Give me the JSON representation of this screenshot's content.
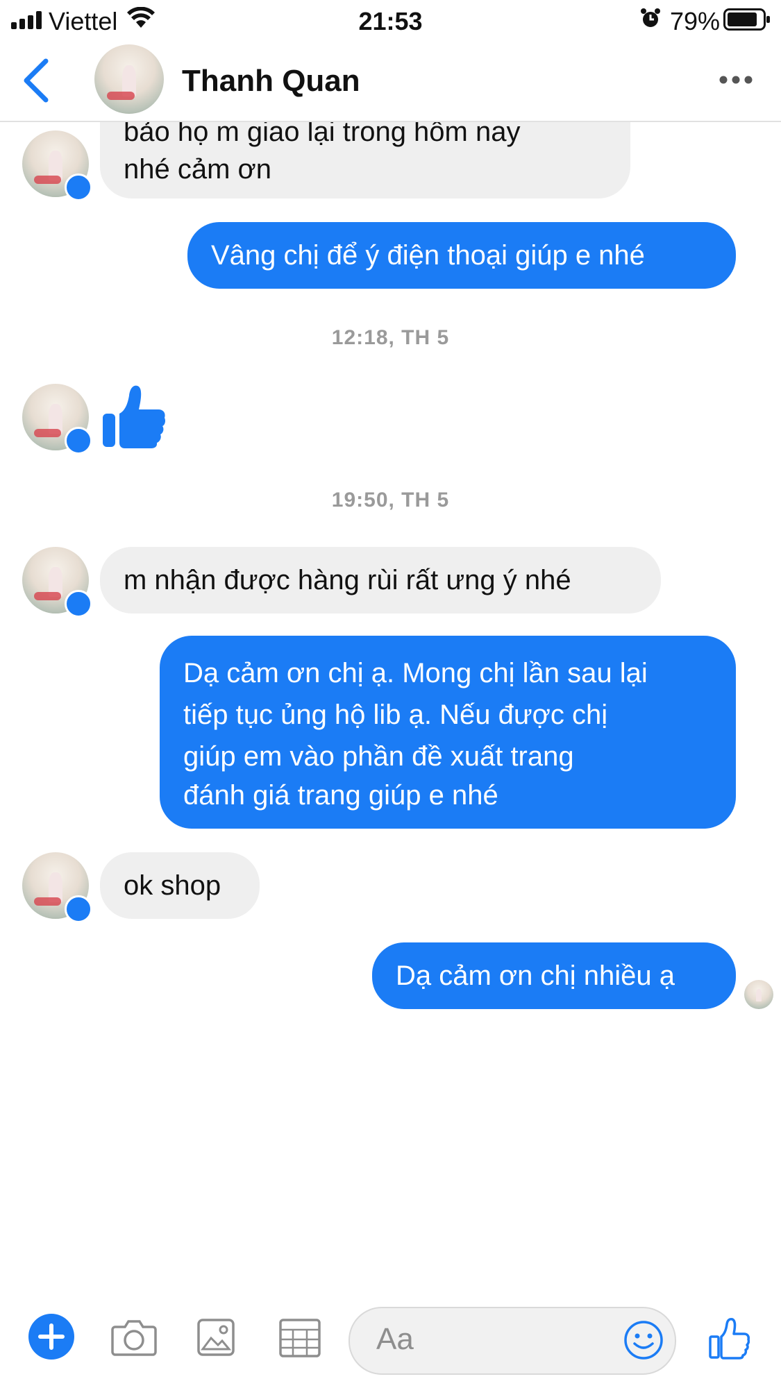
{
  "status_bar": {
    "carrier": "Viettel",
    "time": "21:53",
    "battery": "79%"
  },
  "header": {
    "contact_name": "Thanh Quan"
  },
  "messages": {
    "m1_line1": "bảo họ m giao lại trong hôm nay",
    "m1_line2": "nhé cảm ơn",
    "m2": "Vâng chị để ý điện thoại giúp e nhé",
    "ts1": "12:18, TH 5",
    "ts2": "19:50, TH 5",
    "m3": "m nhận được hàng rùi rất ưng ý nhé",
    "m4_line1": "Dạ cảm ơn chị ạ. Mong chị lần sau lại",
    "m4_line2": "tiếp tục ủng hộ lib ạ. Nếu được chị",
    "m4_line3": "giúp em vào phần đề xuất trang",
    "m4_line4": "đánh giá trang giúp e nhé",
    "m5": "ok shop",
    "m6": "Dạ cảm ơn chị nhiều ạ"
  },
  "composer": {
    "placeholder": "Aa"
  },
  "colors": {
    "accent": "#1b7cf5",
    "incoming_bubble": "#efefef"
  },
  "icons": [
    "signal-icon",
    "wifi-icon",
    "alarm-icon",
    "battery-icon",
    "back-icon",
    "more-icon",
    "like-icon",
    "add-icon",
    "camera-icon",
    "gallery-icon",
    "sticker-icon",
    "emoji-icon",
    "messenger-badge-icon"
  ]
}
